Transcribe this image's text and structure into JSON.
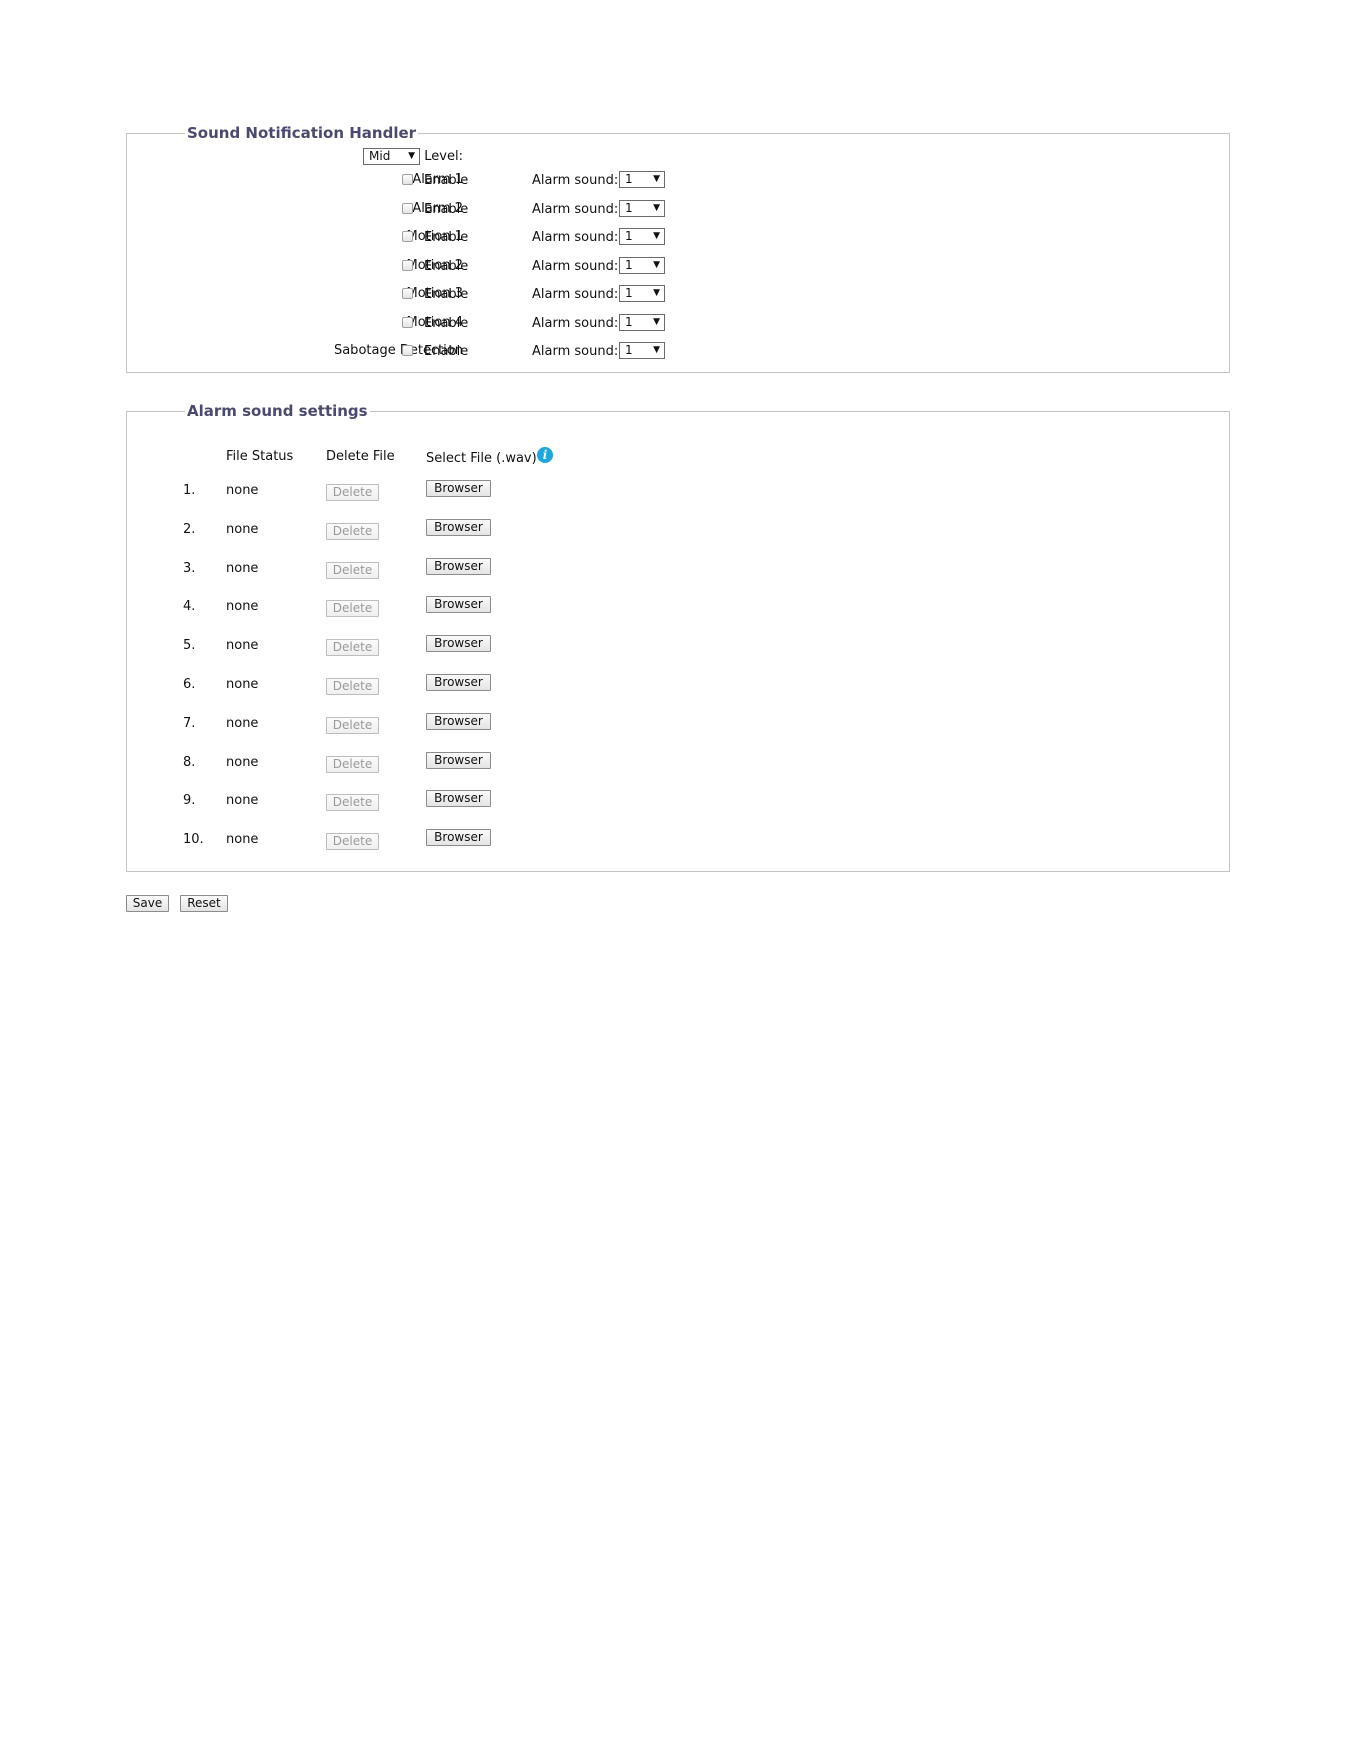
{
  "sound_notification_handler": {
    "legend": "Sound Notification Handler",
    "level_label": "Level:",
    "level_value": "Mid",
    "rows": [
      {
        "label": "Alarm 1",
        "enable_label": "Enable",
        "enabled": false,
        "sound_label": "Alarm sound:",
        "sound_value": "1"
      },
      {
        "label": "Alarm 2",
        "enable_label": "Enable",
        "enabled": false,
        "sound_label": "Alarm sound:",
        "sound_value": "1"
      },
      {
        "label": "Motion 1",
        "enable_label": "Enable",
        "enabled": false,
        "sound_label": "Alarm sound:",
        "sound_value": "1"
      },
      {
        "label": "Motion 2",
        "enable_label": "Enable",
        "enabled": false,
        "sound_label": "Alarm sound:",
        "sound_value": "1"
      },
      {
        "label": "Motion 3",
        "enable_label": "Enable",
        "enabled": false,
        "sound_label": "Alarm sound:",
        "sound_value": "1"
      },
      {
        "label": "Motion 4",
        "enable_label": "Enable",
        "enabled": false,
        "sound_label": "Alarm sound:",
        "sound_value": "1"
      },
      {
        "label": "Sabotage Detection",
        "enable_label": "Enable",
        "enabled": false,
        "sound_label": "Alarm sound:",
        "sound_value": "1"
      }
    ]
  },
  "alarm_sound_settings": {
    "legend": "Alarm sound settings",
    "headers": {
      "file_status": "File Status",
      "delete_file": "Delete File",
      "select_file": "Select File (.wav)"
    },
    "info_icon": "i",
    "rows": [
      {
        "index": "1.",
        "status": "none",
        "delete_label": "Delete",
        "browse_label": "Browser"
      },
      {
        "index": "2.",
        "status": "none",
        "delete_label": "Delete",
        "browse_label": "Browser"
      },
      {
        "index": "3.",
        "status": "none",
        "delete_label": "Delete",
        "browse_label": "Browser"
      },
      {
        "index": "4.",
        "status": "none",
        "delete_label": "Delete",
        "browse_label": "Browser"
      },
      {
        "index": "5.",
        "status": "none",
        "delete_label": "Delete",
        "browse_label": "Browser"
      },
      {
        "index": "6.",
        "status": "none",
        "delete_label": "Delete",
        "browse_label": "Browser"
      },
      {
        "index": "7.",
        "status": "none",
        "delete_label": "Delete",
        "browse_label": "Browser"
      },
      {
        "index": "8.",
        "status": "none",
        "delete_label": "Delete",
        "browse_label": "Browser"
      },
      {
        "index": "9.",
        "status": "none",
        "delete_label": "Delete",
        "browse_label": "Browser"
      },
      {
        "index": "10.",
        "status": "none",
        "delete_label": "Delete",
        "browse_label": "Browser"
      }
    ]
  },
  "actions": {
    "save_label": "Save",
    "reset_label": "Reset"
  },
  "colors": {
    "legend_text": "#4a4a6e",
    "info_icon": "#1ea6e0",
    "border": "#c4c4c4"
  }
}
